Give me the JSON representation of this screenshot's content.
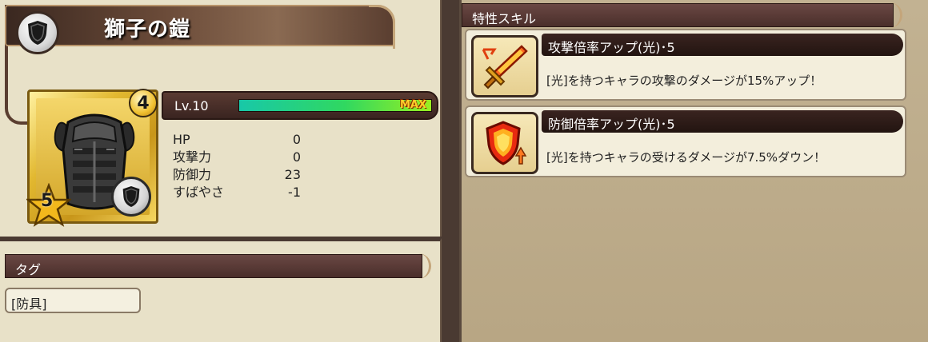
{
  "item": {
    "name": "獅子の鎧",
    "rarity": "4",
    "stars": "5",
    "level_label": "Lv.10",
    "exp_fraction": 1.0,
    "max_label": "MAX"
  },
  "stats": [
    {
      "label": "HP",
      "value": "0"
    },
    {
      "label": "攻撃力",
      "value": "0"
    },
    {
      "label": "防御力",
      "value": "23"
    },
    {
      "label": "すばやさ",
      "value": "-1"
    }
  ],
  "tags": {
    "header": "タグ",
    "items": [
      "[防具]"
    ]
  },
  "skills": {
    "header": "特性スキル",
    "items": [
      {
        "name": "攻撃倍率アップ(光)･5",
        "desc": "[光]を持つキャラの攻撃のダメージが15%アップ！",
        "icon": "sword-icon"
      },
      {
        "name": "防御倍率アップ(光)･5",
        "desc": "[光]を持つキャラの受けるダメージが7.5%ダウン！",
        "icon": "shield-up-icon"
      }
    ]
  },
  "colors": {
    "panel": "#e8e1c8",
    "header": "#4a2e2a",
    "exp_start": "#18c8a8",
    "exp_end": "#9af020",
    "max_text": "#ffcf2a"
  }
}
